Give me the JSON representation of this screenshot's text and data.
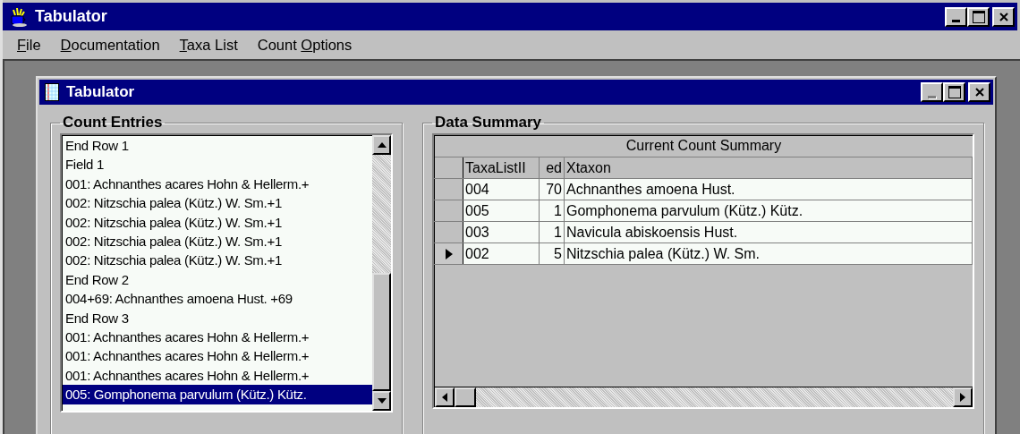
{
  "window": {
    "title": "Tabulator"
  },
  "menu": [
    {
      "key": "F",
      "after": "ile"
    },
    {
      "key": "D",
      "after": "ocumentation"
    },
    {
      "key": "T",
      "after": "axa List"
    },
    {
      "before": "Count ",
      "key": "O",
      "after": "ptions"
    }
  ],
  "child_window": {
    "title": "Tabulator",
    "minimize_disabled": true
  },
  "count_entries": {
    "title": "Count Entries",
    "items": [
      {
        "text": "End Row 1",
        "selected": false
      },
      {
        "text": "Field 1",
        "selected": false
      },
      {
        "text": "001: Achnanthes acares Hohn & Hellerm.+",
        "selected": false
      },
      {
        "text": "002: Nitzschia palea (Kütz.) W. Sm.+1",
        "selected": false
      },
      {
        "text": "002: Nitzschia palea (Kütz.) W. Sm.+1",
        "selected": false
      },
      {
        "text": "002: Nitzschia palea (Kütz.) W. Sm.+1",
        "selected": false
      },
      {
        "text": "002: Nitzschia palea (Kütz.) W. Sm.+1",
        "selected": false
      },
      {
        "text": "End Row 2",
        "selected": false
      },
      {
        "text": "004+69: Achnanthes amoena Hust. +69",
        "selected": false
      },
      {
        "text": "End Row 3",
        "selected": false
      },
      {
        "text": "001: Achnanthes acares Hohn & Hellerm.+",
        "selected": false
      },
      {
        "text": "001: Achnanthes acares Hohn & Hellerm.+",
        "selected": false
      },
      {
        "text": "001: Achnanthes acares Hohn & Hellerm.+",
        "selected": false
      },
      {
        "text": "005: Gomphonema parvulum (Kütz.) Kütz.",
        "selected": true
      }
    ]
  },
  "data_summary": {
    "title": "Data Summary",
    "grid_title": "Current Count Summary",
    "columns": [
      "TaxaListII",
      "ed",
      "Xtaxon"
    ],
    "rows": [
      {
        "cells": [
          "004",
          "70",
          "Achnanthes amoena Hust."
        ],
        "current": false
      },
      {
        "cells": [
          "005",
          "1",
          "Gomphonema parvulum (Kütz.) Kütz."
        ],
        "current": false
      },
      {
        "cells": [
          "003",
          "1",
          "Navicula abiskoensis Hust."
        ],
        "current": false
      },
      {
        "cells": [
          "002",
          "5",
          "Nitzschia palea (Kütz.) W. Sm."
        ],
        "current": true
      }
    ]
  }
}
